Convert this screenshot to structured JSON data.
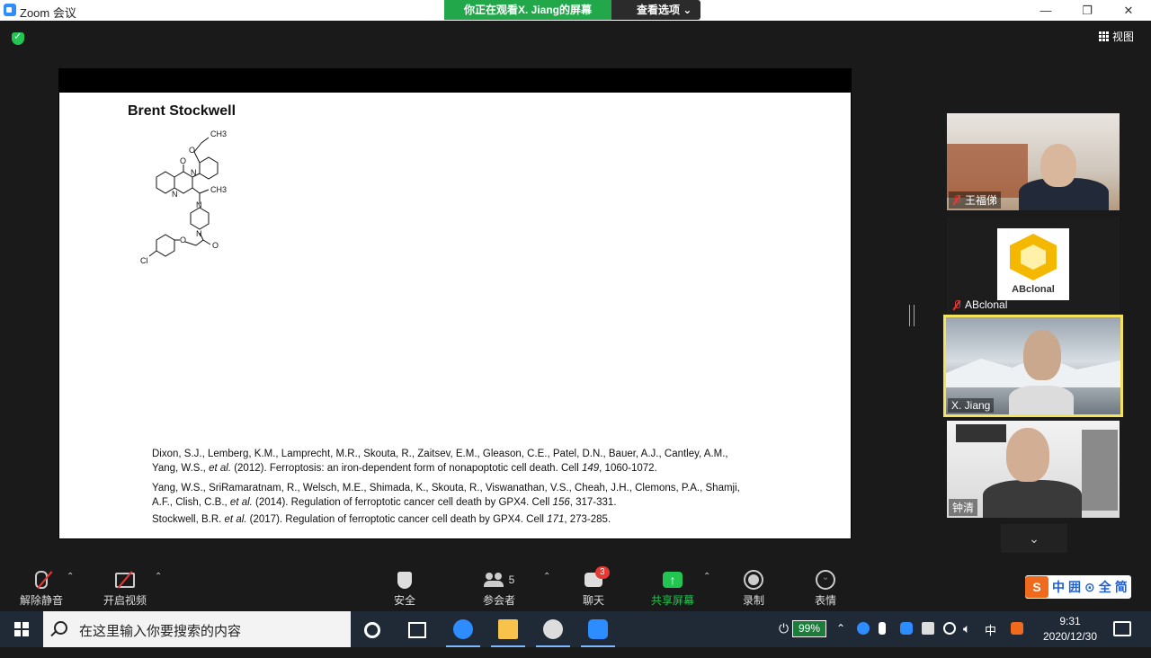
{
  "window": {
    "title": "Zoom 会议"
  },
  "share_banner": {
    "viewing": "你正在观看X. Jiang的屏幕",
    "options": "查看选项 ⌄"
  },
  "view": {
    "label": "视图"
  },
  "slide": {
    "title": "Brent Stockwell",
    "molecule_labels": {
      "ch3_top": "CH3",
      "o_ether": "O",
      "o_carbonyl": "O",
      "n1": "N",
      "n2": "N",
      "ch3_side": "CH3",
      "n_pip1": "N",
      "n_pip2": "N",
      "o_amide": "O",
      "o_aryl": "O",
      "cl": "Cl"
    },
    "references": [
      {
        "line1": "Dixon, S.J., Lemberg, K.M., Lamprecht, M.R., Skouta, R., Zaitsev, E.M., Gleason, C.E., Patel, D.N., Bauer, A.J., Cantley, A.M.,",
        "line2_a": "Yang, W.S., ",
        "line2_etal": "et al.",
        "line2_b": " (2012). Ferroptosis: an iron-dependent form of nonapoptotic cell death. Cell ",
        "line2_vol": "149",
        "line2_c": ", 1060-1072."
      },
      {
        "line1": "Yang, W.S., SriRamaratnam, R., Welsch, M.E., Shimada, K., Skouta, R., Viswanathan, V.S., Cheah, J.H., Clemons, P.A., Shamji,",
        "line2_a": "A.F., Clish, C.B., ",
        "line2_etal": "et al.",
        "line2_b": " (2014). Regulation of ferroptotic cancer cell death by GPX4. Cell ",
        "line2_vol": "156",
        "line2_c": ", 317-331."
      },
      {
        "line1_a": "Stockwell, B.R. ",
        "line1_etal": "et al.",
        "line1_b": " (2017). Regulation of ferroptotic cancer cell death by GPX4. Cell ",
        "line1_vol": "171",
        "line1_c": ", 273-285."
      }
    ]
  },
  "participants": [
    {
      "name": "王福俤",
      "muted": true
    },
    {
      "name": "ABclonal",
      "muted": true,
      "logo_text": "ABclonal"
    },
    {
      "name": "X. Jiang",
      "muted": false,
      "active": true
    },
    {
      "name": "钟清",
      "muted": false
    }
  ],
  "toolbar": {
    "unmute": "解除静音",
    "start_video": "开启视频",
    "security": "安全",
    "participants": "参会者",
    "participants_count": "5",
    "chat": "聊天",
    "chat_badge": "3",
    "share": "共享屏幕",
    "record": "录制",
    "reactions": "表情"
  },
  "ime": {
    "items": [
      "中",
      "囲",
      "⊙",
      "全",
      "简"
    ]
  },
  "taskbar": {
    "search_placeholder": "在这里输入你要搜索的内容",
    "battery": "99%",
    "time": "9:31",
    "date": "2020/12/30"
  },
  "colors": {
    "share_green": "#23c552",
    "active_border": "#f5e25b",
    "zoom_blue": "#2d8cff"
  }
}
